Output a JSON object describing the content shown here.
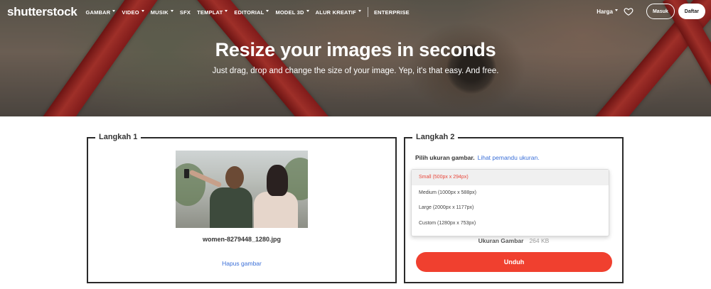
{
  "header": {
    "logo": "shutterstock",
    "menu": [
      {
        "label": "GAMBAR",
        "caret": true
      },
      {
        "label": "VIDEO",
        "caret": true
      },
      {
        "label": "MUSIK",
        "caret": true
      },
      {
        "label": "SFX",
        "caret": false
      },
      {
        "label": "TEMPLAT",
        "caret": true
      },
      {
        "label": "EDITORIAL",
        "caret": true
      },
      {
        "label": "MODEL 3D",
        "caret": true
      },
      {
        "label": "ALUR KREATIF",
        "caret": true
      },
      {
        "label": "ENTERPRISE",
        "caret": false
      }
    ],
    "pricing_label": "Harga",
    "login_label": "Masuk",
    "signup_label": "Daftar"
  },
  "hero": {
    "title": "Resize your images in seconds",
    "subtitle": "Just drag, drop and change the size of your image. Yep, it's that easy. And free."
  },
  "step1": {
    "legend": "Langkah 1",
    "filename": "women-8279448_1280.jpg",
    "remove_label": "Hapus gambar"
  },
  "step2": {
    "legend": "Langkah 2",
    "choose_label": "Pilih ukuran gambar.",
    "guide_link": "Lihat pemandu ukuran.",
    "options": [
      {
        "label": "Small (500px x 294px)",
        "selected": true
      },
      {
        "label": "Medium (1000px x 588px)",
        "selected": false
      },
      {
        "label": "Large (2000px x 1177px)",
        "selected": false
      },
      {
        "label": "Custom (1280px x 753px)",
        "selected": false
      }
    ],
    "size_label": "Ukuran Gambar",
    "size_value": "264 KB",
    "download_label": "Unduh"
  },
  "colors": {
    "accent": "#f0402f",
    "link": "#3a6fd8",
    "selected_option_text": "#e8473b"
  }
}
